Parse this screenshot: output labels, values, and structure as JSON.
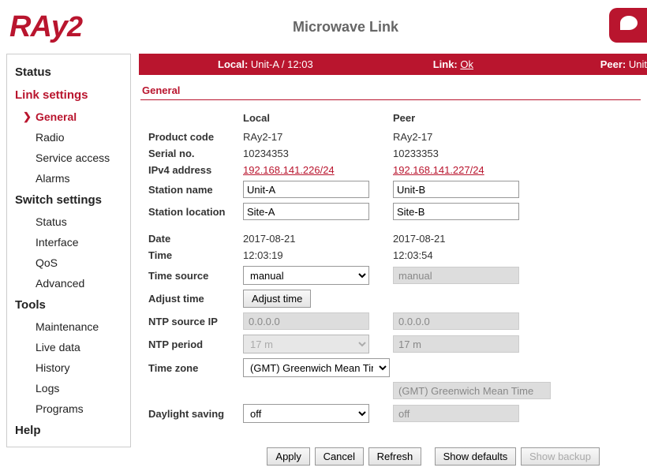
{
  "header": {
    "logo_text": "RAy2",
    "title": "Microwave Link"
  },
  "statusbar": {
    "local_label": "Local:",
    "local_value": "Unit-A / 12:03",
    "link_label": "Link:",
    "link_value": "Ok",
    "peer_label": "Peer:",
    "peer_value": "Unit"
  },
  "sidebar": {
    "groups": [
      {
        "label": "Status",
        "active": false,
        "items": []
      },
      {
        "label": "Link settings",
        "active": true,
        "items": [
          {
            "label": "General",
            "active": true
          },
          {
            "label": "Radio"
          },
          {
            "label": "Service access"
          },
          {
            "label": "Alarms"
          }
        ]
      },
      {
        "label": "Switch settings",
        "active": false,
        "items": [
          {
            "label": "Status"
          },
          {
            "label": "Interface"
          },
          {
            "label": "QoS"
          },
          {
            "label": "Advanced"
          }
        ]
      },
      {
        "label": "Tools",
        "active": false,
        "items": [
          {
            "label": "Maintenance"
          },
          {
            "label": "Live data"
          },
          {
            "label": "History"
          },
          {
            "label": "Logs"
          },
          {
            "label": "Programs"
          }
        ]
      },
      {
        "label": "Help",
        "active": false,
        "items": []
      }
    ]
  },
  "section": {
    "title": "General"
  },
  "columns": {
    "local": "Local",
    "peer": "Peer"
  },
  "labels": {
    "product_code": "Product code",
    "serial_no": "Serial no.",
    "ipv4": "IPv4 address",
    "station_name": "Station name",
    "station_location": "Station location",
    "date": "Date",
    "time": "Time",
    "time_source": "Time source",
    "adjust_time": "Adjust time",
    "ntp_source_ip": "NTP source IP",
    "ntp_period": "NTP period",
    "time_zone": "Time zone",
    "daylight_saving": "Daylight saving"
  },
  "local": {
    "product_code": "RAy2-17",
    "serial_no": "10234353",
    "ipv4": "192.168.141.226/24",
    "station_name": "Unit-A",
    "station_location": "Site-A",
    "date": "2017-08-21",
    "time": "12:03:19",
    "time_source": "manual",
    "ntp_source_ip": "0.0.0.0",
    "ntp_period": "17 m",
    "time_zone": "(GMT) Greenwich Mean Time",
    "daylight_saving": "off"
  },
  "peer": {
    "product_code": "RAy2-17",
    "serial_no": "10233353",
    "ipv4": "192.168.141.227/24",
    "station_name": "Unit-B",
    "station_location": "Site-B",
    "date": "2017-08-21",
    "time": "12:03:54",
    "time_source": "manual",
    "ntp_source_ip": "0.0.0.0",
    "ntp_period": "17 m",
    "time_zone": "(GMT) Greenwich Mean Time",
    "daylight_saving": "off"
  },
  "buttons": {
    "adjust_time": "Adjust time",
    "apply": "Apply",
    "cancel": "Cancel",
    "refresh": "Refresh",
    "show_defaults": "Show defaults",
    "show_backup": "Show backup"
  }
}
